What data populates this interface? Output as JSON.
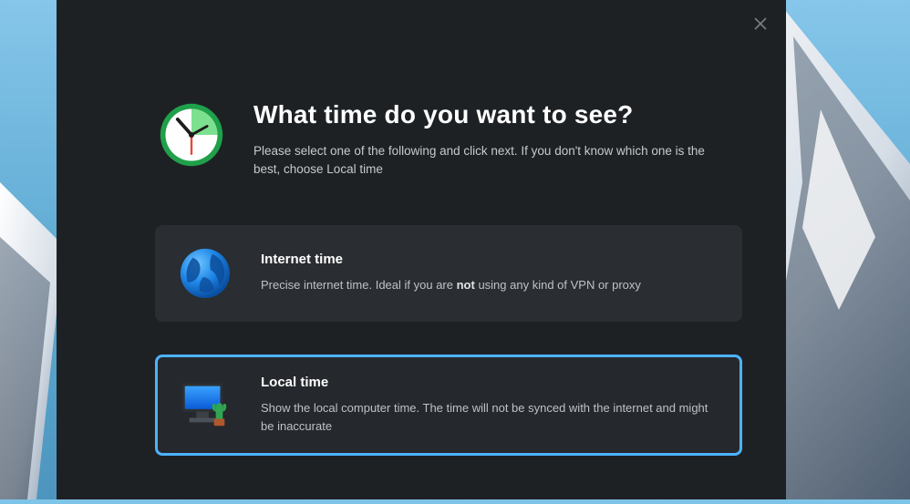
{
  "header": {
    "title": "What time do you want to see?",
    "subtitle": "Please select one of the following and click next. If you don't know which one is the best, choose Local time"
  },
  "options": {
    "internet": {
      "title": "Internet time",
      "desc_before": "Precise internet time. Ideal if you are ",
      "desc_emph": "not",
      "desc_after": " using any kind of VPN or proxy"
    },
    "local": {
      "title": "Local time",
      "desc": "Show the local computer time. The time will not be synced with the internet and might be inaccurate"
    }
  }
}
